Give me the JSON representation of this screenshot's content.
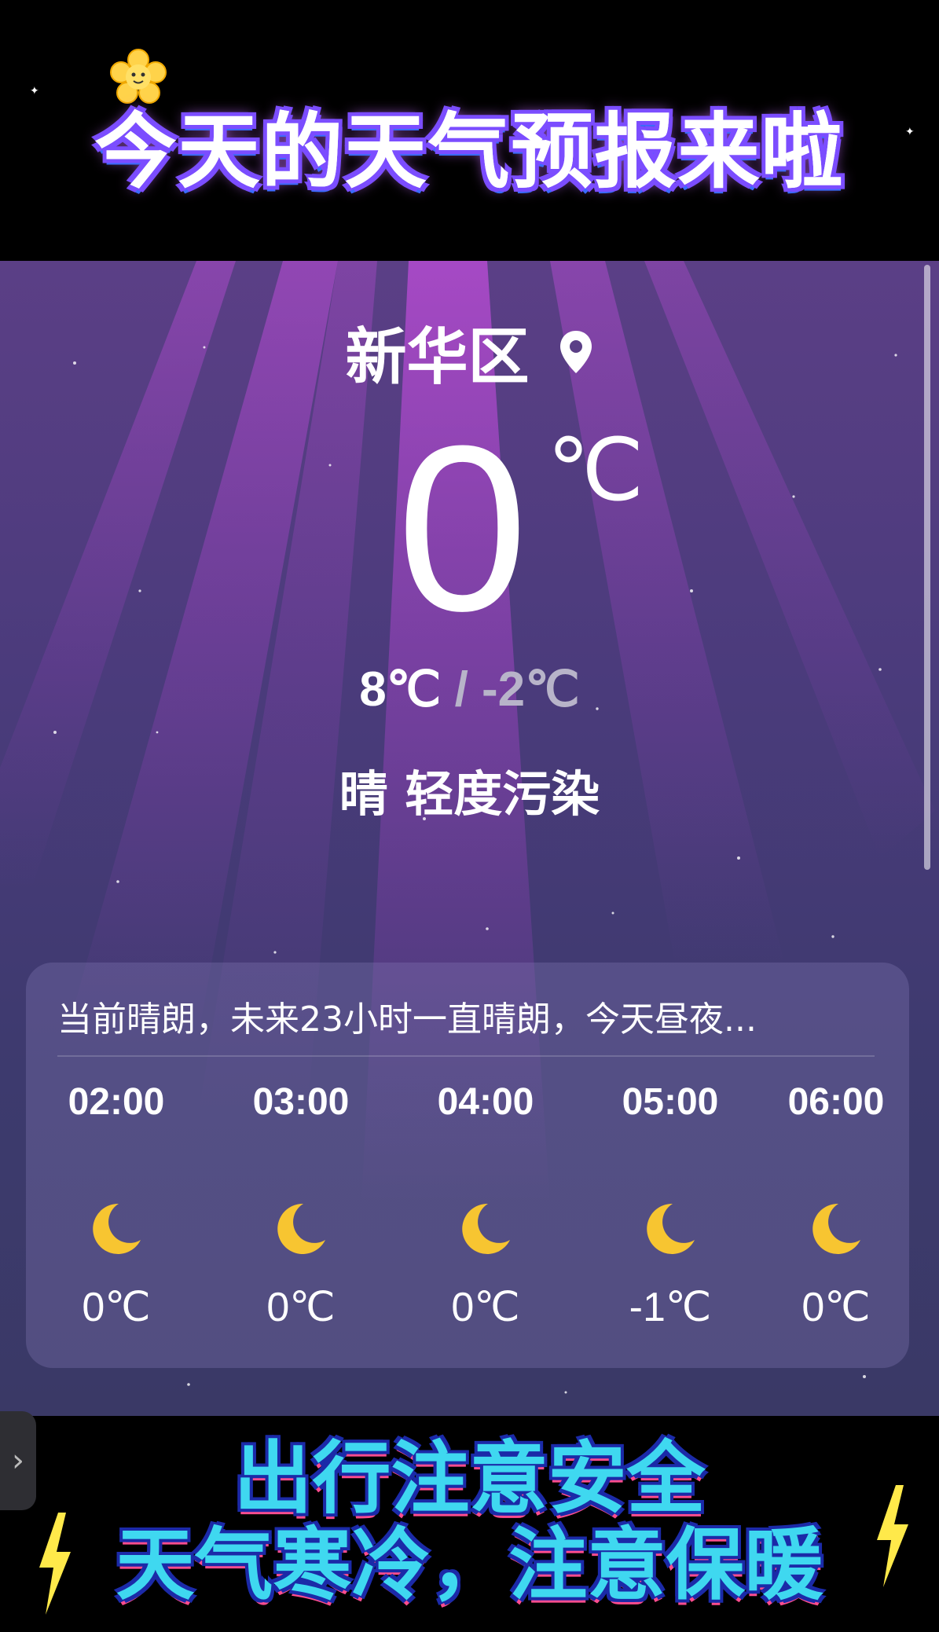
{
  "banner": {
    "title": "今天的天气预报来啦"
  },
  "weather": {
    "city": "新华区",
    "current_temp": "0",
    "unit": "℃",
    "high": "8℃",
    "separator": "/",
    "low": "-2℃",
    "condition": "晴 轻度污染",
    "summary": "当前晴朗，未来23小时一直晴朗，今天昼夜...",
    "hourly": [
      {
        "time": "02:00",
        "icon": "moon-icon",
        "temp": "0℃"
      },
      {
        "time": "03:00",
        "icon": "moon-icon",
        "temp": "0℃"
      },
      {
        "time": "04:00",
        "icon": "moon-icon",
        "temp": "0℃"
      },
      {
        "time": "05:00",
        "icon": "moon-icon",
        "temp": "-1℃"
      },
      {
        "time": "06:00",
        "icon": "moon-icon",
        "temp": "0℃"
      }
    ]
  },
  "footer": {
    "line1": "出行注意安全",
    "line2": "天气寒冷，注意保暖"
  },
  "colors": {
    "panel_top": "#5b3f86",
    "panel_bottom": "#3a3966",
    "moon": "#f7c531",
    "warn_text": "#3fd8f0"
  }
}
